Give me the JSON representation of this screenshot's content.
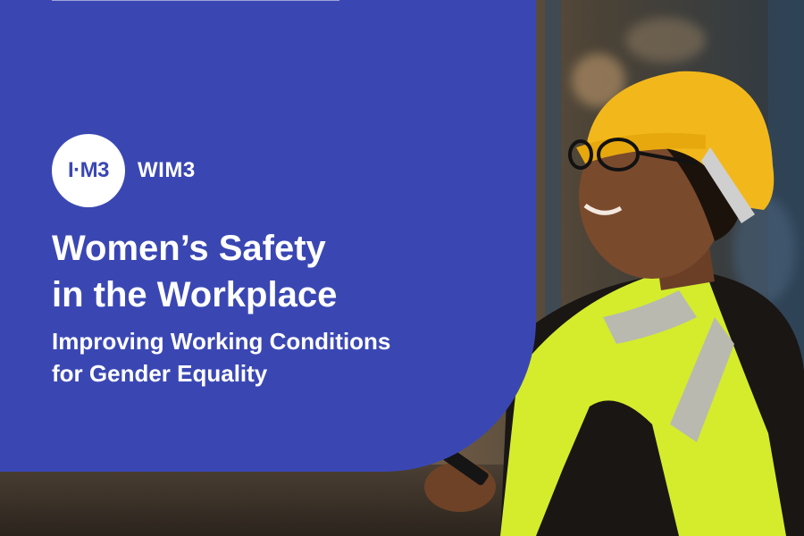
{
  "brand": {
    "badge_text": "I·M3",
    "name": "WIM3",
    "panel_color": "#3a47b3"
  },
  "headline": {
    "title_lines": [
      "Women’s Safety",
      "in the Workplace"
    ],
    "subtitle_lines": [
      "Improving Working Conditions",
      "for Gender Equality"
    ]
  },
  "photo": {
    "subject": "worker-in-hard-hat-and-safety-vest",
    "helmet_color": "#f2b81b",
    "vest_color": "#d8ef2a"
  }
}
